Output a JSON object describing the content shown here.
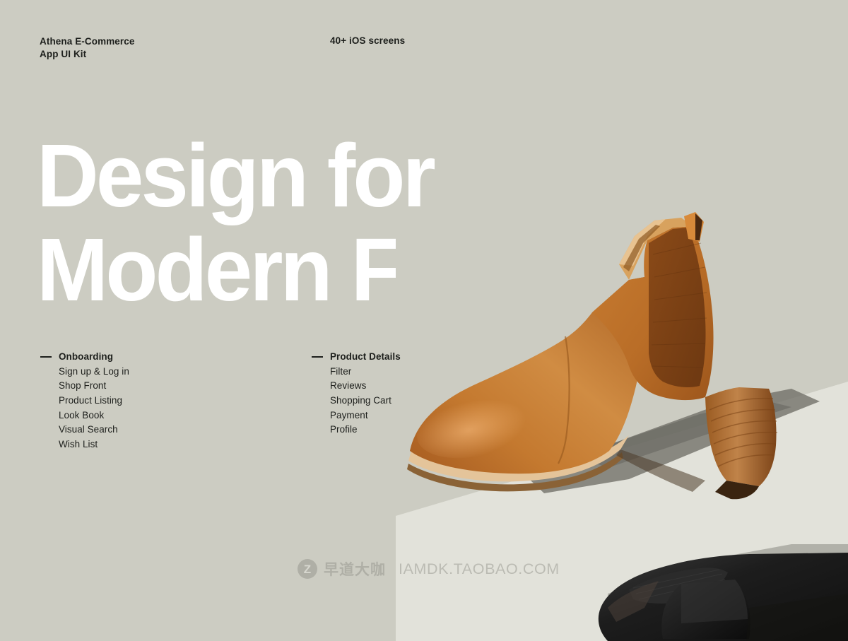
{
  "page": {
    "background_color": "#ccccc2",
    "headline_color": "#ffffff",
    "text_color": "#1d1f1c"
  },
  "header": {
    "brand": "Athena E-Commerce\nApp UI Kit",
    "screens_count": "40+ iOS screens"
  },
  "headline": {
    "text": "Design for\nModern Fashion"
  },
  "lists": [
    {
      "marker": "dash",
      "items": [
        {
          "label": "Onboarding",
          "lead": true
        },
        {
          "label": "Sign up & Log in",
          "lead": false
        },
        {
          "label": "Shop Front",
          "lead": false
        },
        {
          "label": "Product Listing",
          "lead": false
        },
        {
          "label": "Look Book",
          "lead": false
        },
        {
          "label": "Visual Search",
          "lead": false
        },
        {
          "label": "Wish List",
          "lead": false
        }
      ]
    },
    {
      "marker": "dash",
      "items": [
        {
          "label": "Product Details",
          "lead": true
        },
        {
          "label": "Filter",
          "lead": false
        },
        {
          "label": "Reviews",
          "lead": false
        },
        {
          "label": "Shopping Cart",
          "lead": false
        },
        {
          "label": "Payment",
          "lead": false
        },
        {
          "label": "Profile",
          "lead": false
        }
      ]
    }
  ],
  "photo": {
    "alt": "tan-leather-chelsea-boot-and-black-chelsea-boot-product-photo",
    "tan_boot_color": "#c2742f",
    "tan_boot_shadow_color": "#7d7b72",
    "black_boot_color": "#1b1b1b",
    "surface_color": "#e2e2da"
  },
  "watermark": {
    "logo_letter": "Z",
    "chinese_text": "早道大咖",
    "url_text": "IAMDK.TAOBAO.COM",
    "color": "#8d8d85"
  }
}
